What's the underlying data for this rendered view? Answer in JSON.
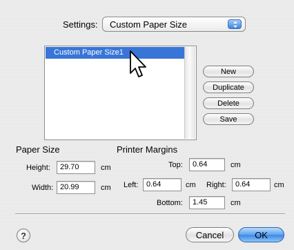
{
  "settings": {
    "label": "Settings:",
    "selected": "Custom Paper Size"
  },
  "paper_list": {
    "items": [
      "Custom Paper Size1"
    ]
  },
  "side_buttons": {
    "new": "New",
    "duplicate": "Duplicate",
    "delete": "Delete",
    "save": "Save"
  },
  "paper_size": {
    "heading": "Paper Size",
    "height_label": "Height:",
    "height_value": "29.70",
    "width_label": "Width:",
    "width_value": "20.99",
    "unit": "cm"
  },
  "margins": {
    "heading": "Printer Margins",
    "top_label": "Top:",
    "top_value": "0.64",
    "left_label": "Left:",
    "left_value": "0.64",
    "right_label": "Right:",
    "right_value": "0.64",
    "bottom_label": "Bottom:",
    "bottom_value": "1.45",
    "unit": "cm"
  },
  "footer": {
    "help": "?",
    "cancel": "Cancel",
    "ok": "OK"
  },
  "colors": {
    "selection": "#3875d7",
    "default_button": "#3b88e6"
  }
}
